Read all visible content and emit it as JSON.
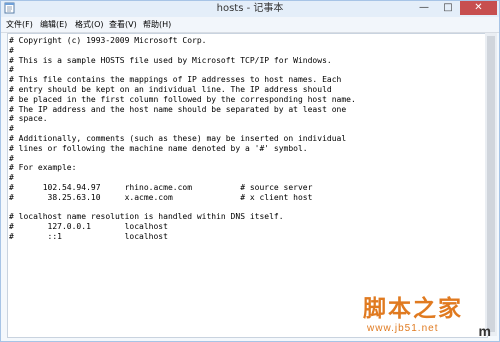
{
  "window": {
    "title": "hosts - 记事本",
    "controls": {
      "minimize": "—",
      "maximize": "□",
      "close": "✕"
    }
  },
  "menu": {
    "items": [
      {
        "label": "文件(F)"
      },
      {
        "label": "编辑(E)"
      },
      {
        "label": "格式(O)"
      },
      {
        "label": "查看(V)"
      },
      {
        "label": "帮助(H)"
      }
    ]
  },
  "document": {
    "lines": [
      "# Copyright (c) 1993-2009 Microsoft Corp.",
      "#",
      "# This is a sample HOSTS file used by Microsoft TCP/IP for Windows.",
      "#",
      "# This file contains the mappings of IP addresses to host names. Each",
      "# entry should be kept on an individual line. The IP address should",
      "# be placed in the first column followed by the corresponding host name.",
      "# The IP address and the host name should be separated by at least one",
      "# space.",
      "#",
      "# Additionally, comments (such as these) may be inserted on individual",
      "# lines or following the machine name denoted by a '#' symbol.",
      "#",
      "# For example:",
      "#",
      "#      102.54.94.97     rhino.acme.com          # source server",
      "#       38.25.63.10     x.acme.com              # x client host",
      "",
      "# localhost name resolution is handled within DNS itself.",
      "#       127.0.0.1       localhost",
      "#       ::1             localhost"
    ]
  },
  "watermark": {
    "title": "脚本之家",
    "url": "www.jb51.net"
  },
  "corner_glyph": "m",
  "icons": {
    "app": "notepad-icon"
  }
}
